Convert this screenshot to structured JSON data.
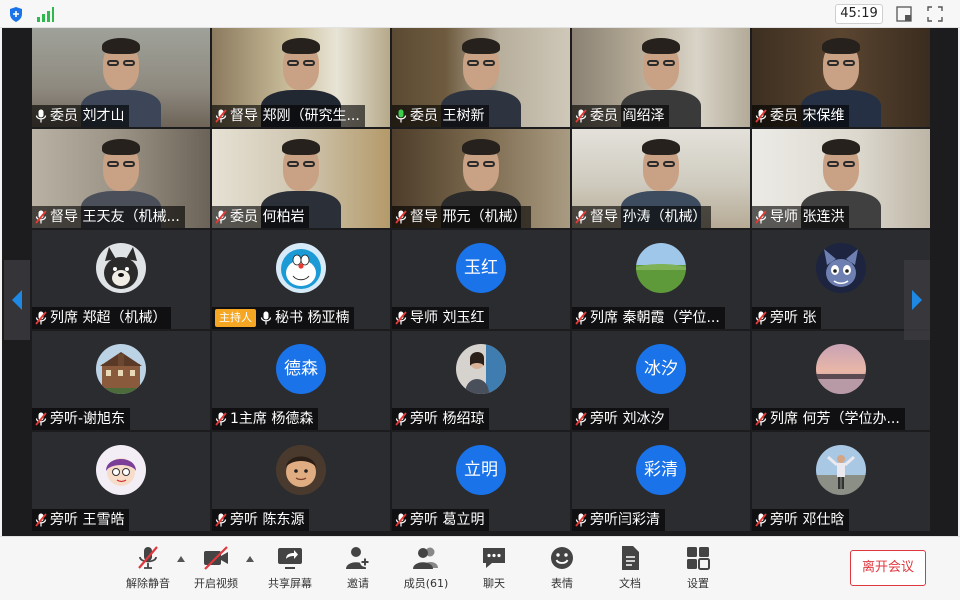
{
  "topbar": {
    "timer": "45:19",
    "security_icon": "shield-icon",
    "network_icon": "signal-bars-icon"
  },
  "tiles": [
    {
      "label": "委员 刘才山",
      "mic": "on",
      "kind": "video"
    },
    {
      "label": "督导 郑刚（研究生...",
      "mic": "muted",
      "kind": "video"
    },
    {
      "label": "委员 王树新",
      "mic": "on",
      "kind": "video"
    },
    {
      "label": "委员 阎绍泽",
      "mic": "muted",
      "kind": "video"
    },
    {
      "label": "委员 宋保维",
      "mic": "muted",
      "kind": "video"
    },
    {
      "label": "督导 王天友（机械...",
      "mic": "muted",
      "kind": "video"
    },
    {
      "label": "委员 何柏岩",
      "mic": "muted",
      "kind": "video"
    },
    {
      "label": "督导 邢元（机械）",
      "mic": "muted",
      "kind": "video"
    },
    {
      "label": "督导 孙涛（机械）",
      "mic": "muted",
      "kind": "video"
    },
    {
      "label": "导师 张连洪",
      "mic": "muted",
      "kind": "video"
    },
    {
      "label": "列席 郑超（机械）",
      "mic": "muted",
      "kind": "avatar",
      "avatar": "dog"
    },
    {
      "label": "秘书 杨亚楠",
      "mic": "on",
      "kind": "avatar",
      "avatar": "doraemon",
      "badge": "主持人"
    },
    {
      "label": "导师 刘玉红",
      "mic": "muted",
      "kind": "avatar",
      "avatar_text": "玉红"
    },
    {
      "label": "列席 秦朝霞（学位...",
      "mic": "muted",
      "kind": "avatar",
      "avatar": "landscape"
    },
    {
      "label": "旁听 张",
      "mic": "muted",
      "kind": "avatar",
      "avatar": "cartoon-cat"
    },
    {
      "label": "旁听-谢旭东",
      "mic": "muted",
      "kind": "avatar",
      "avatar": "building"
    },
    {
      "label": "1主席 杨德森",
      "mic": "muted",
      "kind": "avatar",
      "avatar_text": "德森"
    },
    {
      "label": "旁听 杨绍琼",
      "mic": "muted",
      "kind": "avatar",
      "avatar": "photo"
    },
    {
      "label": "旁听 刘冰汐",
      "mic": "muted",
      "kind": "avatar",
      "avatar_text": "冰汐"
    },
    {
      "label": "列席 何芳（学位办...",
      "mic": "muted",
      "kind": "avatar",
      "avatar": "sunset"
    },
    {
      "label": "旁听 王雪皓",
      "mic": "muted",
      "kind": "avatar",
      "avatar": "cartoon-girl"
    },
    {
      "label": "旁听 陈东源",
      "mic": "muted",
      "kind": "avatar",
      "avatar": "cartoon-face"
    },
    {
      "label": "旁听 葛立明",
      "mic": "muted",
      "kind": "avatar",
      "avatar_text": "立明"
    },
    {
      "label": "旁听闫彩清",
      "mic": "muted",
      "kind": "avatar",
      "avatar_text": "彩清"
    },
    {
      "label": "旁听 邓仕晗",
      "mic": "muted",
      "kind": "avatar",
      "avatar": "person-outdoor"
    }
  ],
  "toolbar": {
    "unmute": "解除静音",
    "start_video": "开启视频",
    "share_screen": "共享屏幕",
    "invite": "邀请",
    "members": "成员(61)",
    "chat": "聊天",
    "reactions": "表情",
    "documents": "文档",
    "settings": "设置",
    "leave": "离开会议"
  },
  "colors": {
    "accent": "#1a73e8",
    "danger": "#e0383e",
    "host_badge": "#f5a623",
    "nav_arrow": "#1e88e5"
  }
}
